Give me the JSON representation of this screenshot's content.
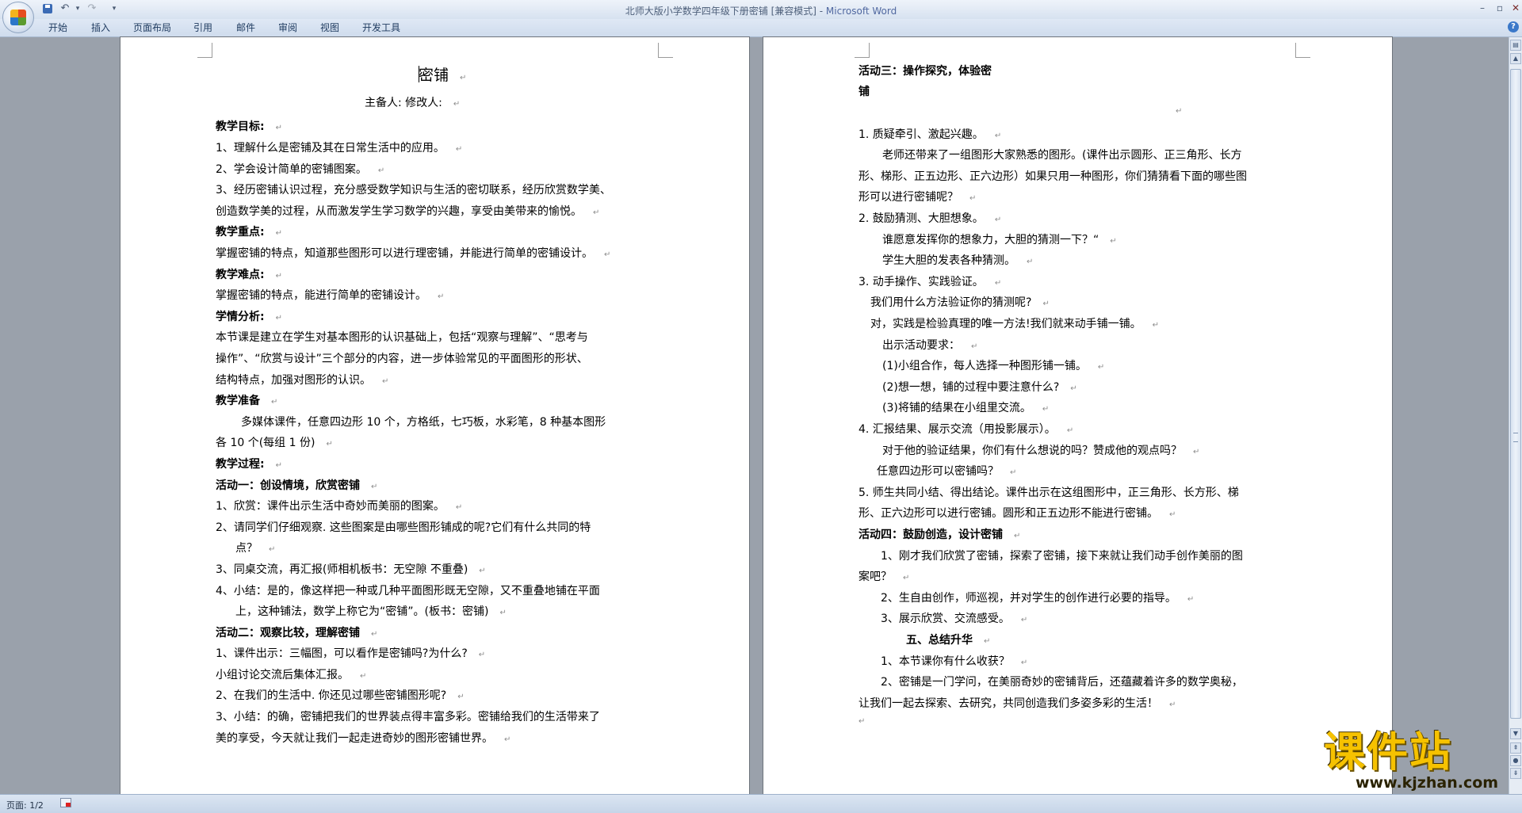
{
  "window": {
    "title": "北师大版小学数学四年级下册密铺 [兼容模式] - ",
    "app_name": "Microsoft Word",
    "controls": {
      "minimize": "–",
      "restore": "▫",
      "close": "✕"
    }
  },
  "quick_access": {
    "undo_icon": "↶",
    "redo_icon": "↷",
    "dropdown_icon": "▾",
    "more_icon": "▾"
  },
  "ribbon": {
    "tabs": [
      "开始",
      "插入",
      "页面布局",
      "引用",
      "邮件",
      "审阅",
      "视图",
      "开发工具"
    ],
    "help_icon": "?"
  },
  "scrollbar": {
    "up": "▲",
    "down": "▼",
    "prev_page": "⇞",
    "browse": "●",
    "next_page": "⇟",
    "ruler": "▤"
  },
  "status": {
    "page": "页面: 1/2"
  },
  "page1": {
    "title": "密铺",
    "subtitle": "主备人:        修改人:",
    "lines": [
      "教学目标:",
      "1、理解什么是密铺及其在日常生活中的应用。",
      "2、学会设计简单的密铺图案。",
      "3、经历密铺认识过程，充分感受数学知识与生活的密切联系，经历欣赏数学美、",
      "创造数学美的过程，从而激发学生学习数学的兴趣，享受由美带来的愉悦。",
      "教学重点:",
      "掌握密铺的特点，知道那些图形可以进行理密铺，并能进行简单的密铺设计。",
      "教学难点:",
      "掌握密铺的特点，能进行简单的密铺设计。",
      "学情分析:",
      "本节课是建立在学生对基本图形的认识基础上，包括“观察与理解”、“思考与",
      "操作”、“欣赏与设计”三个部分的内容，进一步体验常见的平面图形的形状、",
      "结构特点，加强对图形的认识。",
      "教学准备",
      "多媒体课件，任意四边形 10 个，方格纸，七巧板，水彩笔，8 种基本图形",
      "各 10 个(每组 1 份)",
      "教学过程:",
      "活动一：创设情境，欣赏密铺",
      "1、欣赏：课件出示生活中奇妙而美丽的图案。",
      "2、请同学们仔细观察. 这些图案是由哪些图形铺成的呢?它们有什么共同的特",
      "点？",
      "3、同桌交流，再汇报(师相机板书：无空隙       不重叠)",
      "4、小结：是的，像这样把一种或几种平面图形既无空隙，又不重叠地铺在平面",
      "上，这种铺法，数学上称它为“密铺”。(板书：密铺)",
      "活动二：观察比较，理解密铺",
      "1、课件出示：三幅图，可以看作是密铺吗?为什么?",
      "小组讨论交流后集体汇报。",
      "2、在我们的生活中. 你还见过哪些密铺图形呢?",
      "3、小结：的确，密铺把我们的世界装点得丰富多彩。密铺给我们的生活带来了",
      "美的享受，今天就让我们一起走进奇妙的图形密铺世界。"
    ]
  },
  "page2": {
    "lines": [
      "活动三：操作探究，体验密",
      "铺",
      "1. 质疑牵引、激起兴趣。",
      "老师还带来了一组图形大家熟悉的图形。(课件出示圆形、正三角形、长方",
      "形、梯形、正五边形、正六边形）如果只用一种图形，你们猜猜看下面的哪些图",
      "形可以进行密铺呢？",
      "2. 鼓励猜测、大胆想象。",
      "谁愿意发挥你的想象力，大胆的猜测一下？“",
      "学生大胆的发表各种猜测。",
      "3. 动手操作、实践验证。",
      "我们用什么方法验证你的猜测呢?",
      "对，实践是检验真理的唯一方法!我们就来动手铺一铺。",
      "出示活动要求：",
      "(1)小组合作，每人选择一种图形铺一铺。",
      "(2)想一想，铺的过程中要注意什么?",
      "(3)将铺的结果在小组里交流。",
      "4. 汇报结果、展示交流（用投影展示）。",
      "对于他的验证结果，你们有什么想说的吗？赞成他的观点吗？",
      "任意四边形可以密铺吗？",
      "5. 师生共同小结、得出结论。课件出示在这组图形中，正三角形、长方形、梯",
      "形、正六边形可以进行密铺。圆形和正五边形不能进行密铺。",
      "活动四：鼓励创造，设计密铺",
      "1、刚才我们欣赏了密铺，探索了密铺，接下来就让我们动手创作美丽的图",
      "案吧？",
      "2、生自由创作，师巡视，并对学生的创作进行必要的指导。",
      "3、展示欣赏、交流感受。",
      "五、总结升华",
      "1、本节课你有什么收获？",
      "2、密铺是一门学问，在美丽奇妙的密铺背后，还蕴藏着许多的数学奥秘，",
      "让我们一起去探索、去研究，共同创造我们多姿多彩的生活！"
    ]
  },
  "watermark": {
    "main": "课件站",
    "url": "www.kjzhan.com"
  }
}
